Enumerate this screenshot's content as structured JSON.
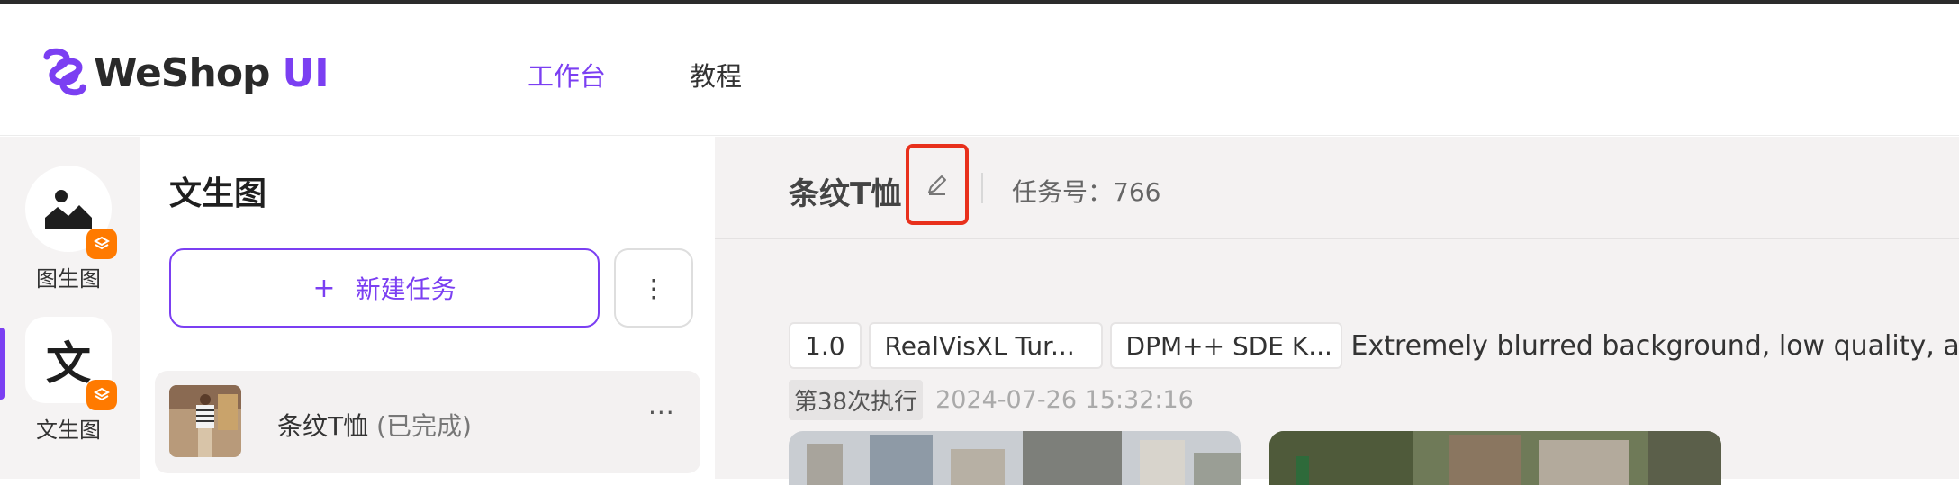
{
  "header": {
    "logo_text": "WeShop",
    "logo_suffix": "UI",
    "nav": {
      "workbench": "工作台",
      "tutorial": "教程"
    },
    "accent_color": "#7b3ff2"
  },
  "rail": {
    "items": [
      {
        "label": "图生图",
        "icon": "image-icon"
      },
      {
        "label": "文生图",
        "icon": "text-wen-icon",
        "glyph": "文",
        "active": true
      }
    ]
  },
  "panel": {
    "title": "文生图",
    "new_task_label": "新建任务",
    "more_label": "⋮",
    "tasks": [
      {
        "name": "条纹T恤",
        "status": "(已完成)",
        "menu": "···"
      }
    ]
  },
  "main": {
    "title": "条纹T恤",
    "task_no": "任务号：766",
    "chips": {
      "cfg": "1.0",
      "model": "RealVisXL Tur...",
      "sampler": "DPM++ SDE K..."
    },
    "prompt": "Extremely blurred background, low quality, a c",
    "run_badge": "第38次执行",
    "run_time": "2024-07-26 15:32:16"
  }
}
